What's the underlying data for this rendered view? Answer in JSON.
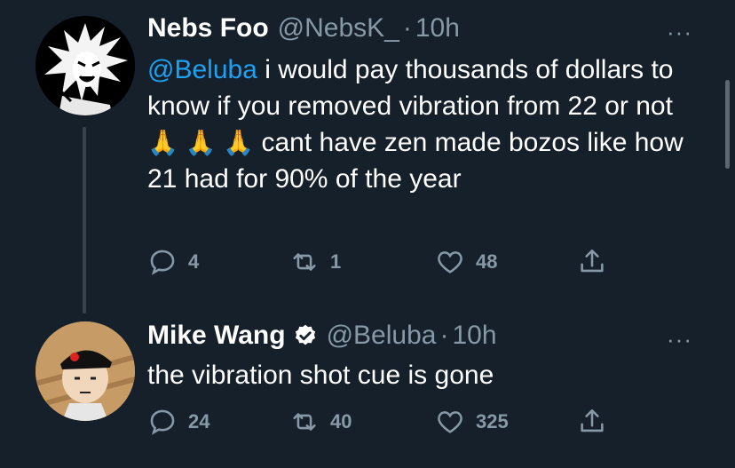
{
  "tweets": [
    {
      "name": "Nebs Foo",
      "handle": "@NebsK_",
      "separator": "·",
      "time": "10h",
      "more": "···",
      "text_mention": "@Beluba",
      "text_part1": " i would pay thousands of dollars to know if you removed vibration from 22 or not ",
      "text_emoji": "🙏 🙏 🙏",
      "text_part2": " cant have zen made bozos like how 21 had for 90% of the year",
      "replies": "4",
      "retweets": "1",
      "likes": "48"
    },
    {
      "name": "Mike Wang",
      "handle": "@Beluba",
      "separator": "·",
      "time": "10h",
      "more": "···",
      "text": "the vibration shot cue is gone",
      "replies": "24",
      "retweets": "40",
      "likes": "325"
    }
  ],
  "colors": {
    "background": "#15202b",
    "text": "#ffffff",
    "secondary": "#8899a6",
    "mention": "#1da1f2"
  }
}
